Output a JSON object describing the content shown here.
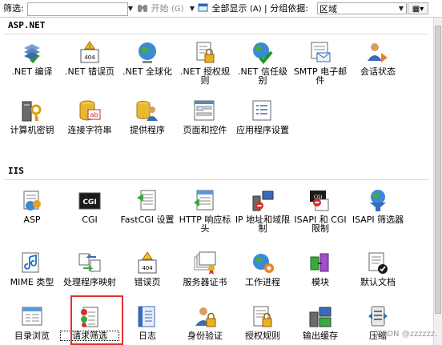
{
  "toolbar": {
    "filter_label": "筛选:",
    "start_label": "开始",
    "start_shortcut": "(G)",
    "show_all_label": "全部显示",
    "show_all_shortcut": "(A)",
    "group_by_label": "| 分组依据:",
    "group_by_value": "区域"
  },
  "sections": [
    {
      "title": "ASP.NET",
      "features": [
        {
          "label": ".NET 编译",
          "icon": "compile-icon"
        },
        {
          "label": ".NET 错误页",
          "icon": "error-404-icon"
        },
        {
          "label": ".NET 全球化",
          "icon": "globe-icon"
        },
        {
          "label": ".NET 授权规则",
          "icon": "lock-document-icon"
        },
        {
          "label": ".NET 信任级别",
          "icon": "trust-icon"
        },
        {
          "label": "SMTP 电子邮件",
          "icon": "email-icon"
        },
        {
          "label": "会话状态",
          "icon": "session-icon"
        },
        {
          "label": "计算机密钥",
          "icon": "machine-key-icon"
        },
        {
          "label": "连接字符串",
          "icon": "database-ab-icon"
        },
        {
          "label": "提供程序",
          "icon": "provider-icon"
        },
        {
          "label": "页面和控件",
          "icon": "page-controls-icon"
        },
        {
          "label": "应用程序设置",
          "icon": "app-settings-icon"
        }
      ]
    },
    {
      "title": "IIS",
      "features": [
        {
          "label": "ASP",
          "icon": "asp-icon"
        },
        {
          "label": "CGI",
          "icon": "cgi-icon"
        },
        {
          "label": "FastCGI 设置",
          "icon": "fastcgi-icon"
        },
        {
          "label": "HTTP 响应标头",
          "icon": "http-headers-icon"
        },
        {
          "label": "IP 地址和域限制",
          "icon": "ip-restrictions-icon"
        },
        {
          "label": "ISAPI 和 CGI 限制",
          "icon": "isapi-cgi-icon"
        },
        {
          "label": "ISAPI 筛选器",
          "icon": "isapi-filter-icon"
        },
        {
          "label": "MIME 类型",
          "icon": "mime-icon"
        },
        {
          "label": "处理程序映射",
          "icon": "handler-mapping-icon"
        },
        {
          "label": "错误页",
          "icon": "error-pages-icon"
        },
        {
          "label": "服务器证书",
          "icon": "certificate-icon"
        },
        {
          "label": "工作进程",
          "icon": "worker-process-icon"
        },
        {
          "label": "模块",
          "icon": "modules-icon"
        },
        {
          "label": "默认文档",
          "icon": "default-doc-icon"
        },
        {
          "label": "目录浏览",
          "icon": "directory-browse-icon"
        },
        {
          "label": "请求筛选",
          "icon": "request-filter-icon"
        },
        {
          "label": "日志",
          "icon": "logging-icon"
        },
        {
          "label": "身份验证",
          "icon": "authentication-icon"
        },
        {
          "label": "授权规则",
          "icon": "authorization-icon"
        },
        {
          "label": "输出缓存",
          "icon": "output-cache-icon"
        },
        {
          "label": "压缩",
          "icon": "compression-icon"
        }
      ]
    }
  ],
  "watermark": "CSDN @zzzzzz.",
  "colors": {
    "highlight": "#e03030",
    "accent": "#1e6ec8"
  }
}
